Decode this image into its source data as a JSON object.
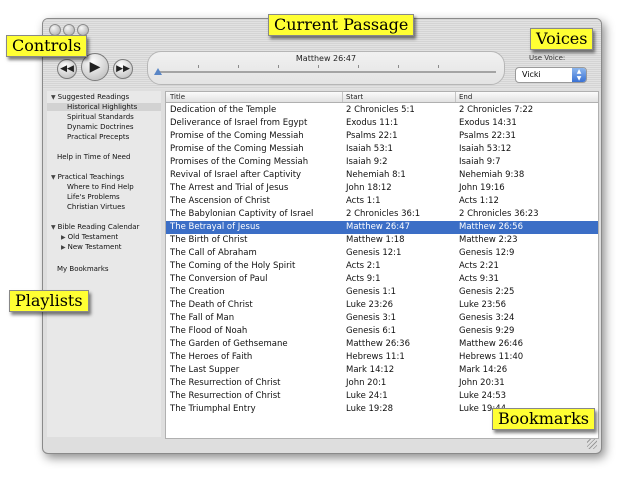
{
  "player": {
    "current_passage": "Matthew 26:47",
    "controls": {
      "rewind_icon": "rewind-icon",
      "play_icon": "play-icon",
      "forward_icon": "fast-forward-icon"
    }
  },
  "voice": {
    "label": "Use Voice:",
    "value": "Vicki"
  },
  "sidebar": {
    "groups": [
      {
        "label": "Suggested Readings",
        "expanded": true,
        "items": [
          "Historical Highlights",
          "Spiritual Standards",
          "Dynamic Doctrines",
          "Practical Precepts"
        ]
      },
      {
        "label": "Help in Time of Need"
      },
      {
        "label": "Practical Teachings",
        "expanded": true,
        "items": [
          "Where to Find Help",
          "Life's Problems",
          "Christian Virtues"
        ]
      },
      {
        "label": "Bible Reading Calendar",
        "expanded": true,
        "items": [
          "Old Testament",
          "New Testament"
        ]
      },
      {
        "label": "My Bookmarks"
      }
    ],
    "selected": "Historical Highlights"
  },
  "table": {
    "columns": [
      "Title",
      "Start",
      "End"
    ],
    "selected_index": 9,
    "rows": [
      [
        "Dedication of the Temple",
        "2 Chronicles 5:1",
        "2 Chronicles 7:22"
      ],
      [
        "Deliverance of Israel from Egypt",
        "Exodus 11:1",
        "Exodus 14:31"
      ],
      [
        "Promise of the Coming Messiah",
        "Psalms 22:1",
        "Psalms 22:31"
      ],
      [
        "Promise of the Coming Messiah",
        "Isaiah 53:1",
        "Isaiah 53:12"
      ],
      [
        "Promises of the Coming Messiah",
        "Isaiah 9:2",
        "Isaiah 9:7"
      ],
      [
        "Revival of Israel after Captivity",
        "Nehemiah 8:1",
        "Nehemiah 9:38"
      ],
      [
        "The Arrest and Trial of Jesus",
        "John 18:12",
        "John 19:16"
      ],
      [
        "The Ascension of Christ",
        "Acts 1:1",
        "Acts 1:12"
      ],
      [
        "The Babylonian Captivity of Israel",
        "2 Chronicles 36:1",
        "2 Chronicles 36:23"
      ],
      [
        "The Betrayal of Jesus",
        "Matthew 26:47",
        "Matthew 26:56"
      ],
      [
        "The Birth of Christ",
        "Matthew 1:18",
        "Matthew 2:23"
      ],
      [
        "The Call of Abraham",
        "Genesis 12:1",
        "Genesis 12:9"
      ],
      [
        "The Coming of the Holy Spirit",
        "Acts 2:1",
        "Acts 2:21"
      ],
      [
        "The Conversion of Paul",
        "Acts 9:1",
        "Acts 9:31"
      ],
      [
        "The Creation",
        "Genesis 1:1",
        "Genesis 2:25"
      ],
      [
        "The Death of Christ",
        "Luke 23:26",
        "Luke 23:56"
      ],
      [
        "The Fall of Man",
        "Genesis 3:1",
        "Genesis 3:24"
      ],
      [
        "The Flood of Noah",
        "Genesis 6:1",
        "Genesis 9:29"
      ],
      [
        "The Garden of Gethsemane",
        "Matthew 26:36",
        "Matthew 26:46"
      ],
      [
        "The Heroes of Faith",
        "Hebrews 11:1",
        "Hebrews 11:40"
      ],
      [
        "The Last Supper",
        "Mark 14:12",
        "Mark 14:26"
      ],
      [
        "The Resurrection of Christ",
        "John 20:1",
        "John 20:31"
      ],
      [
        "The Resurrection of Christ",
        "Luke 24:1",
        "Luke 24:53"
      ],
      [
        "The Triumphal Entry",
        "Luke 19:28",
        "Luke 19:44"
      ]
    ]
  },
  "callouts": {
    "controls": "Controls",
    "current_passage": "Current Passage",
    "voices": "Voices",
    "playlists": "Playlists",
    "bookmarks": "Bookmarks"
  }
}
